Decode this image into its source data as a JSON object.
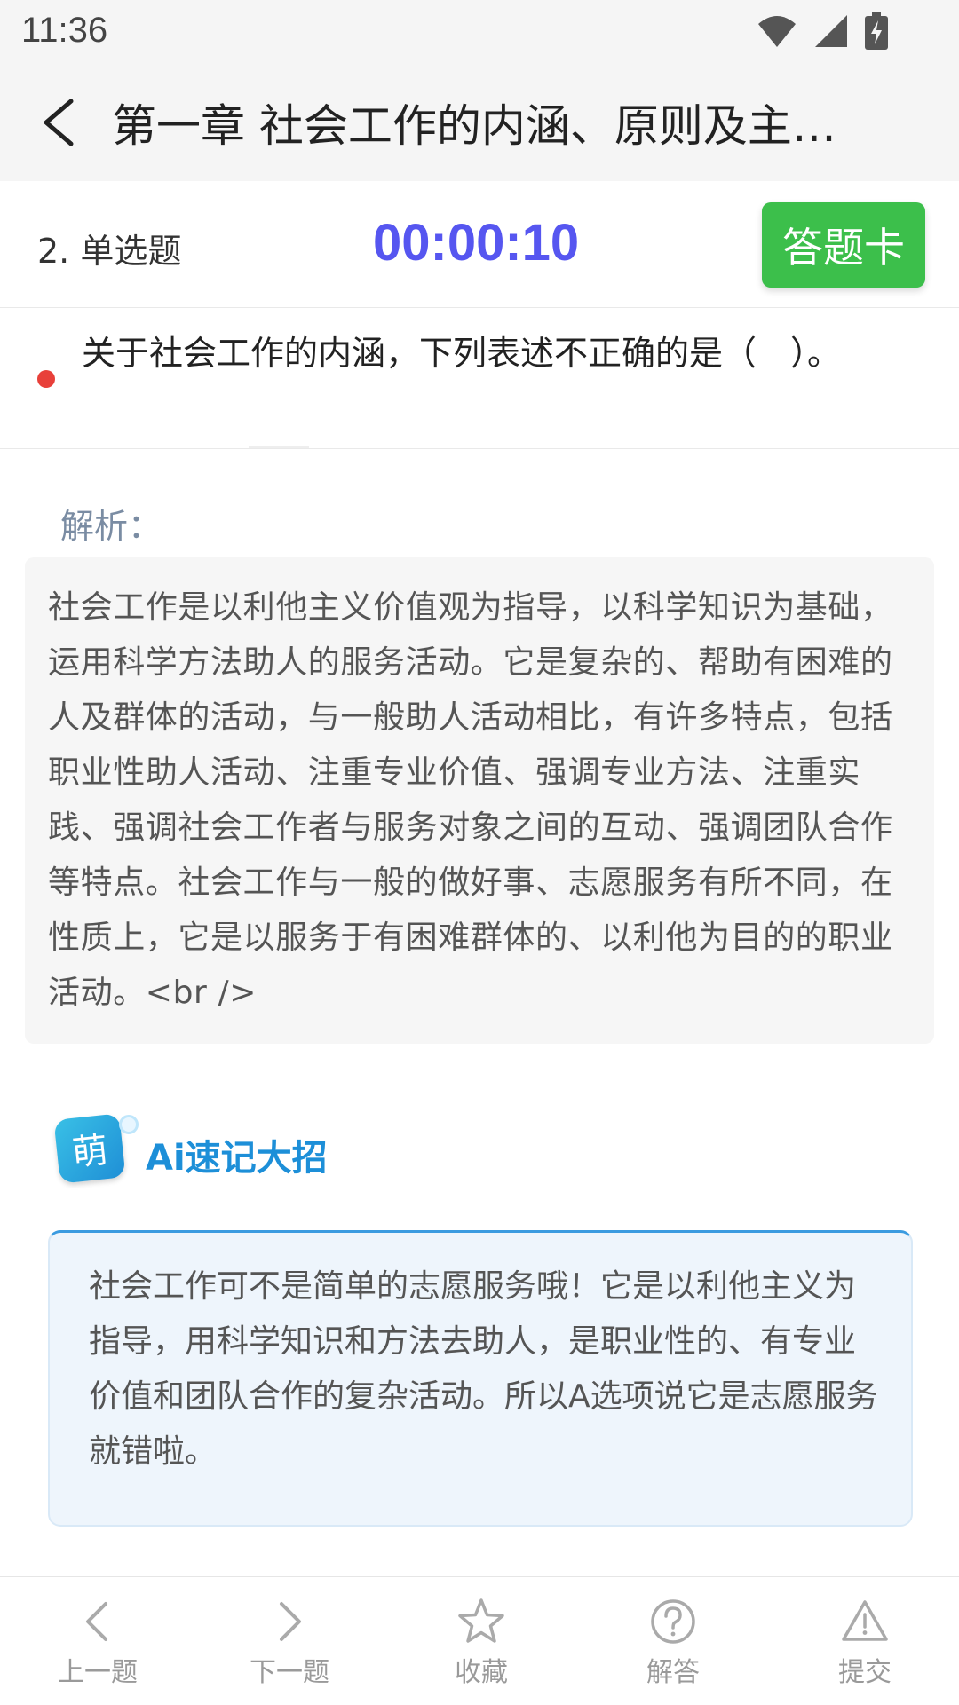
{
  "status_bar": {
    "time": "11:36"
  },
  "app_bar": {
    "title": "第一章 社会工作的内涵、原则及主…"
  },
  "question_header": {
    "type_label": "2. 单选题",
    "timer": "00:00:10",
    "answer_card_label": "答题卡"
  },
  "question": {
    "text": "关于社会工作的内涵，下列表述不正确的是（　）。"
  },
  "analysis": {
    "label": "解析：",
    "text": "社会工作是以利他主义价值观为指导，以科学知识为基础，运用科学方法助人的服务活动。它是复杂的、帮助有困难的人及群体的活动，与一般助人活动相比，有许多特点，包括职业性助人活动、注重专业价值、强调专业方法、注重实践、强调社会工作者与服务对象之间的互动、强调团队合作等特点。社会工作与一般的做好事、志愿服务有所不同，在性质上，它是以服务于有困难群体的、以利他为目的的职业活动。<br />"
  },
  "ai_tip": {
    "badge": "萌",
    "title": "Ai速记大招",
    "text": "社会工作可不是简单的志愿服务哦！它是以利他主义为指导，用科学知识和方法去助人，是职业性的、有专业价值和团队合作的复杂活动。所以A选项说它是志愿服务就错啦。"
  },
  "bottom_nav": {
    "items": [
      {
        "label": "上一题",
        "icon": "chevron-left-icon"
      },
      {
        "label": "下一题",
        "icon": "chevron-right-icon"
      },
      {
        "label": "收藏",
        "icon": "star-icon"
      },
      {
        "label": "解答",
        "icon": "question-circle-icon"
      },
      {
        "label": "提交",
        "icon": "warning-triangle-icon"
      }
    ]
  },
  "colors": {
    "timer": "#5656f0",
    "answer_card": "#3cbf4b",
    "dot": "#e8403a",
    "ai_title": "#1d8fd8"
  }
}
